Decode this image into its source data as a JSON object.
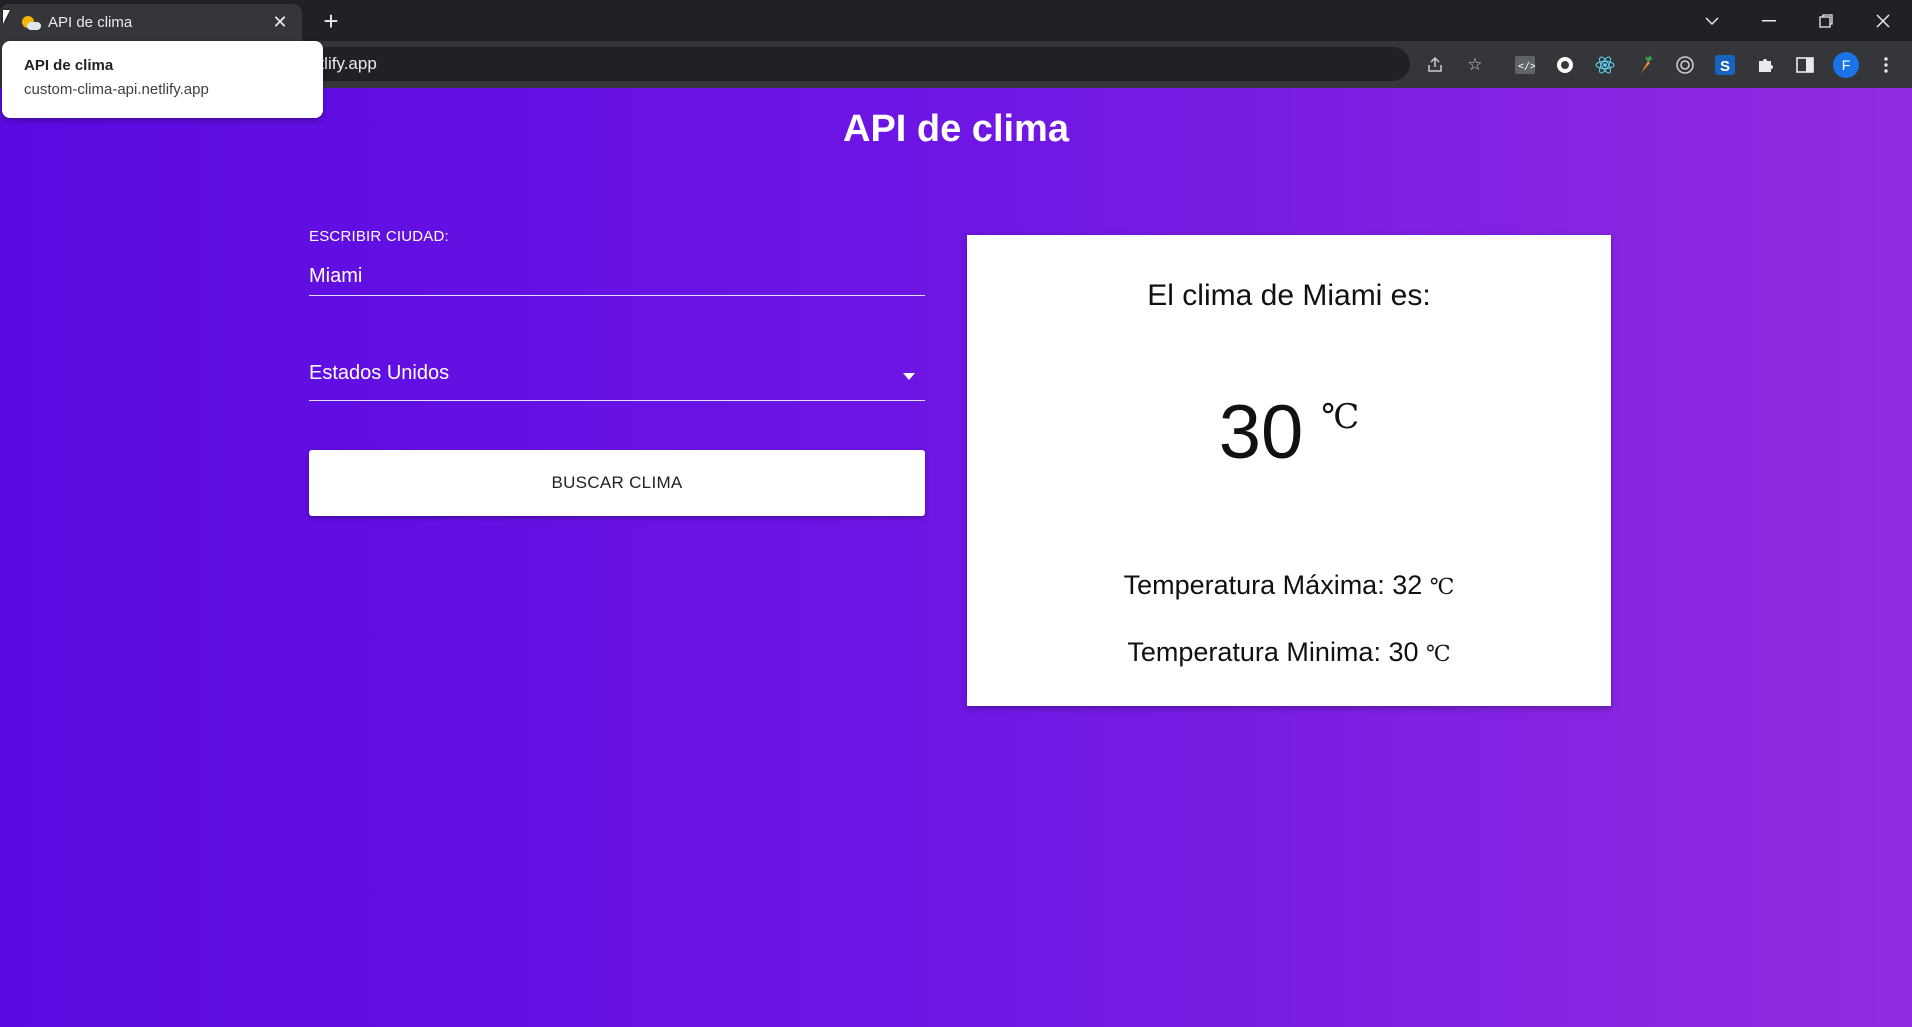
{
  "browser": {
    "tab_title": "API de clima",
    "close_glyph": "✕",
    "new_tab_glyph": "+",
    "url_visible": "etlify.app",
    "profile_initial": "F",
    "hover_card": {
      "title": "API de clima",
      "url": "custom-clima-api.netlify.app"
    },
    "window_controls": [
      "chevron-down-icon",
      "minimize-icon",
      "restore-icon",
      "close-icon"
    ],
    "toolbar_icons": [
      "share-icon",
      "star-icon",
      "devtools-extension-icon",
      "circle-extension-icon",
      "react-devtools-icon",
      "carrot-extension-icon",
      "target-extension-icon",
      "s-extension-icon",
      "puzzle-extensions-icon",
      "side-panel-icon",
      "menu-dots-icon"
    ]
  },
  "app": {
    "title": "API de clima",
    "form": {
      "city_label": "ESCRIBIR CIUDAD:",
      "city_value": "Miami",
      "country_selected": "Estados Unidos",
      "search_button": "BUSCAR CLIMA"
    },
    "result": {
      "heading": "El clima de Miami es:",
      "temperature": "30",
      "unit": "℃",
      "max_label": "Temperatura Máxima: 32",
      "min_label": "Temperatura Minima: 30"
    }
  },
  "colors": {
    "gradient_start": "#5a0ae1",
    "gradient_end": "#922be0",
    "card_bg": "#ffffff"
  }
}
